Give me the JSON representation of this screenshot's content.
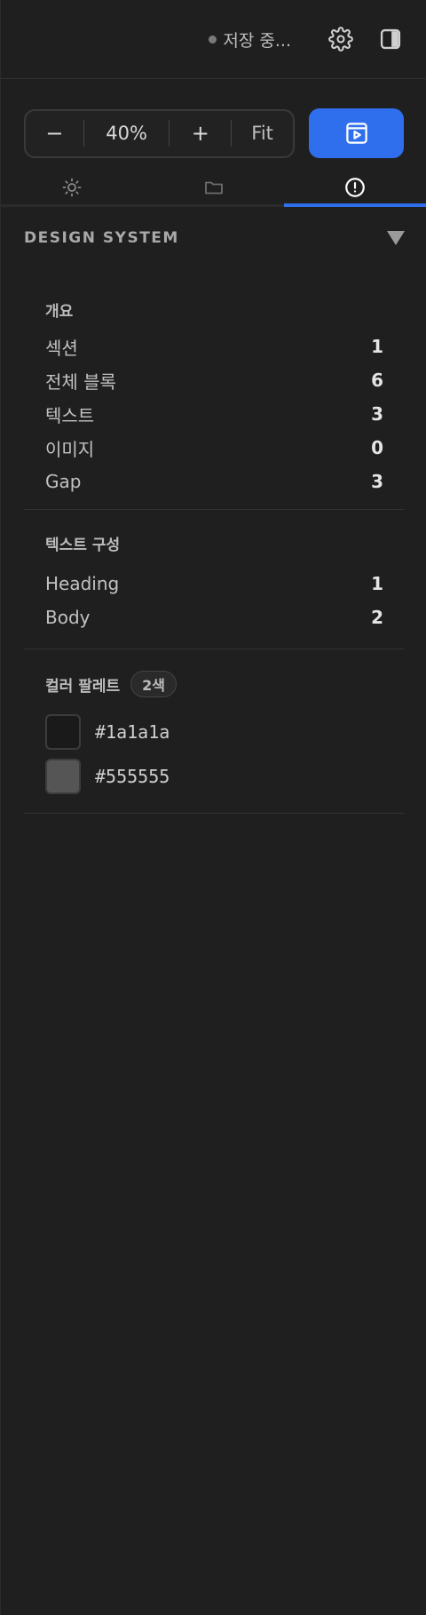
{
  "topbar": {
    "status_text": "저장 중...",
    "settings_icon": "gear-icon",
    "panel_icon": "sidebar-toggle-icon"
  },
  "zoom": {
    "minus_label": "−",
    "value": "40%",
    "plus_label": "+",
    "fit_label": "Fit",
    "preview_icon": "play-preview-icon"
  },
  "tabs": [
    {
      "icon": "sun-icon",
      "active": false
    },
    {
      "icon": "folder-icon",
      "active": false
    },
    {
      "icon": "alert-circle-icon",
      "active": true
    }
  ],
  "design_system": {
    "title": "DESIGN SYSTEM",
    "overview": {
      "title": "개요",
      "rows": [
        {
          "label": "섹션",
          "value": "1"
        },
        {
          "label": "전체 블록",
          "value": "6"
        },
        {
          "label": "텍스트",
          "value": "3"
        },
        {
          "label": "이미지",
          "value": "0"
        },
        {
          "label": "Gap",
          "value": "3"
        }
      ]
    },
    "text_composition": {
      "title": "텍스트 구성",
      "rows": [
        {
          "label": "Heading",
          "value": "1"
        },
        {
          "label": "Body",
          "value": "2"
        }
      ]
    },
    "palette": {
      "title": "컬러 팔레트",
      "badge": "2색",
      "colors": [
        {
          "hex": "#1a1a1a",
          "label": "#1a1a1a"
        },
        {
          "hex": "#555555",
          "label": "#555555"
        }
      ]
    }
  },
  "colors": {
    "accent": "#2f6fed",
    "background": "#1f1f1f"
  }
}
